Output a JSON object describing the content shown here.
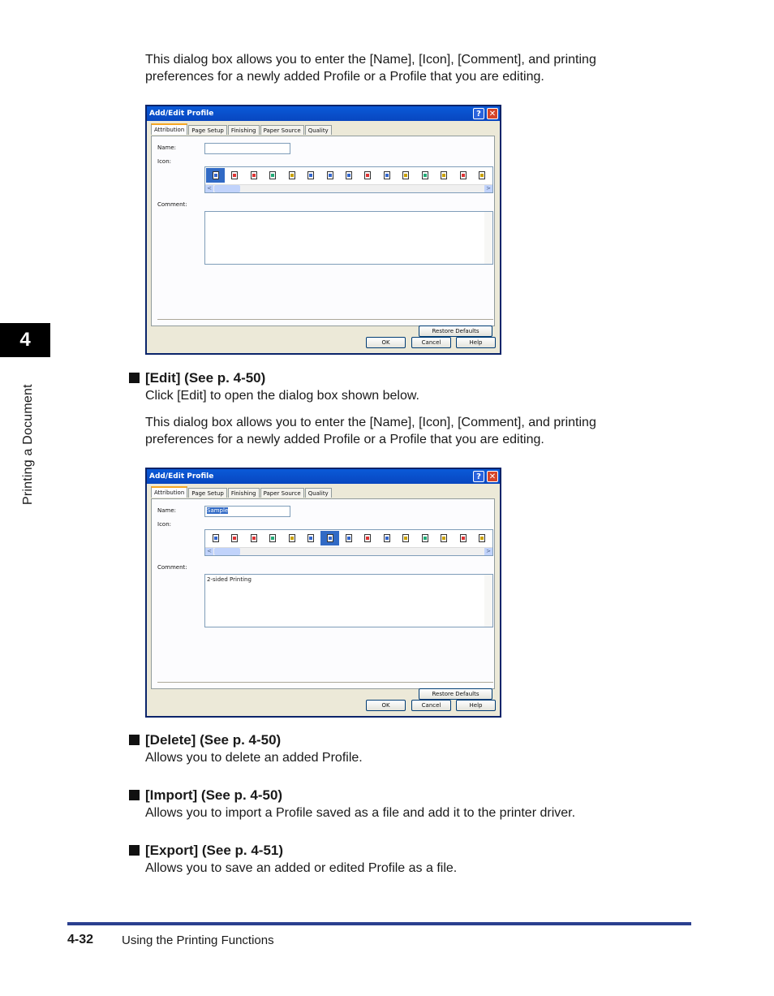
{
  "intro": {
    "line1": "This dialog box allows you to enter the [Name], [Icon], [Comment], and printing",
    "line2": "preferences for a newly added Profile or a Profile that you are editing."
  },
  "dialog_common": {
    "title": "Add/Edit Profile",
    "help_glyph": "?",
    "close_glyph": "✕",
    "tabs": [
      "Attribution",
      "Page Setup",
      "Finishing",
      "Paper Source",
      "Quality"
    ],
    "name_label": "Name:",
    "icon_label": "Icon:",
    "comment_label": "Comment:",
    "restore_label": "Restore Defaults",
    "ok_label": "OK",
    "cancel_label": "Cancel",
    "help_label": "Help",
    "scroll_left": "<",
    "scroll_right": ">"
  },
  "dialog1": {
    "name_value": "",
    "comment_value": ""
  },
  "dialog2": {
    "name_value": "Sample",
    "comment_value": "2-sided Printing"
  },
  "edit": {
    "heading": "[Edit] (See p. 4-50)",
    "text1": "Click [Edit] to open the dialog box shown below.",
    "text2a": "This dialog box allows you to enter the [Name], [Icon], [Comment], and printing",
    "text2b": "preferences for a newly added Profile or a Profile that you are editing."
  },
  "delete": {
    "heading": "[Delete] (See p. 4-50)",
    "text": "Allows you to delete an added Profile."
  },
  "import": {
    "heading": "[Import] (See p. 4-50)",
    "text": "Allows you to import a Profile saved as a file and add it to the printer driver."
  },
  "export": {
    "heading": "[Export] (See p. 4-51)",
    "text": "Allows you to save an added or edited Profile as a file."
  },
  "sidebar": {
    "chapter_number": "4",
    "chapter_title": "Printing a Document"
  },
  "footer": {
    "page_number": "4-32",
    "section": "Using the Printing Functions"
  }
}
